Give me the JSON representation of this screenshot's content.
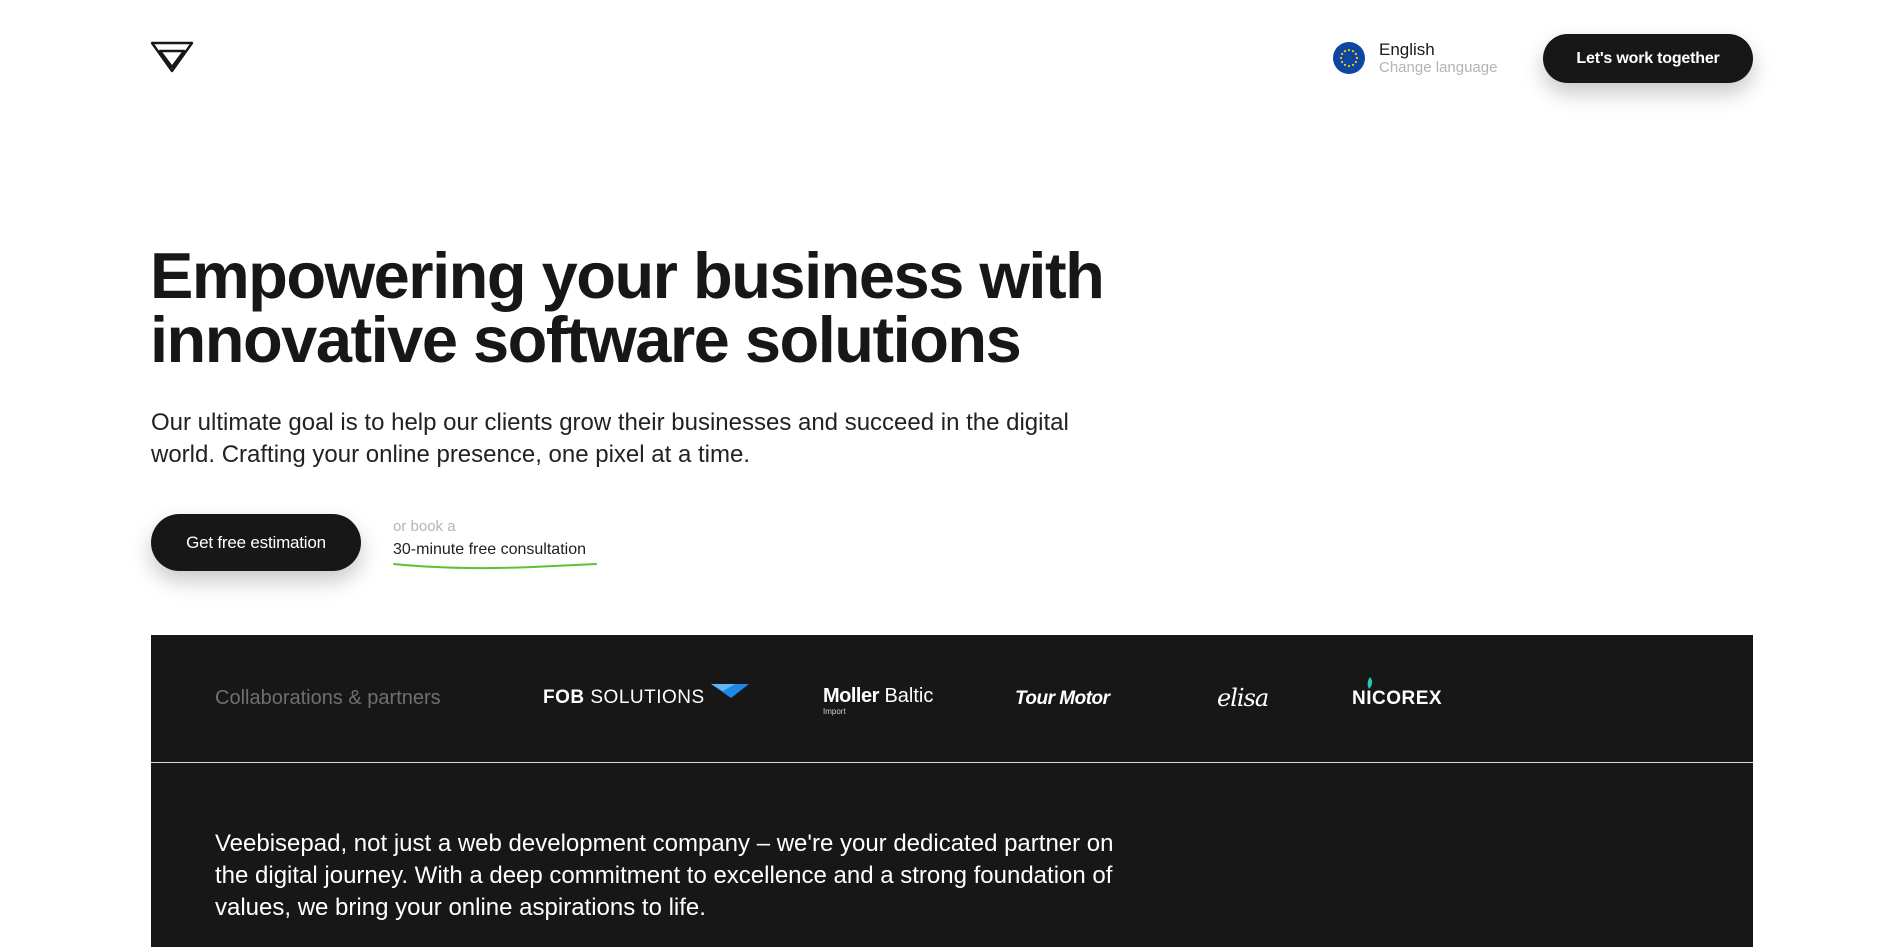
{
  "header": {
    "logo_icon": "veebisepad-logo-icon",
    "language": {
      "flag_icon": "eu-flag-icon",
      "name": "English",
      "sub": "Change language"
    },
    "cta_label": "Let's work together"
  },
  "hero": {
    "title_line1": "Empowering your business with",
    "title_line2": "innovative software solutions",
    "subtitle_line1": "Our ultimate goal is to help our clients grow their businesses and succeed in the digital",
    "subtitle_line2": "world. Crafting your online presence, one pixel at a time.",
    "primary_cta": "Get free estimation",
    "or_text": "or book a",
    "consult_link": "30-minute free consultation",
    "accent_color": "#5bc236"
  },
  "partners": {
    "label": "Collaborations & partners",
    "logos": [
      {
        "bold": "FOB",
        "rest": " SOLUTIONS"
      },
      {
        "bold": "Moller",
        "rest": "Baltic",
        "small": "Import"
      },
      {
        "text": "Tour Motor"
      },
      {
        "text": "elisa"
      },
      {
        "text": "NICOREX"
      }
    ]
  },
  "about": {
    "line1": "Veebisepad, not just a web development company – we're your dedicated partner on",
    "line2": "the digital journey. With a deep commitment to excellence and a strong foundation of",
    "line3": "values, we bring your online aspirations to life."
  },
  "colors": {
    "dark": "#171717",
    "muted": "#b4b4b4",
    "eu_blue": "#0d47a1",
    "fob_blue": "#1e88e5"
  }
}
